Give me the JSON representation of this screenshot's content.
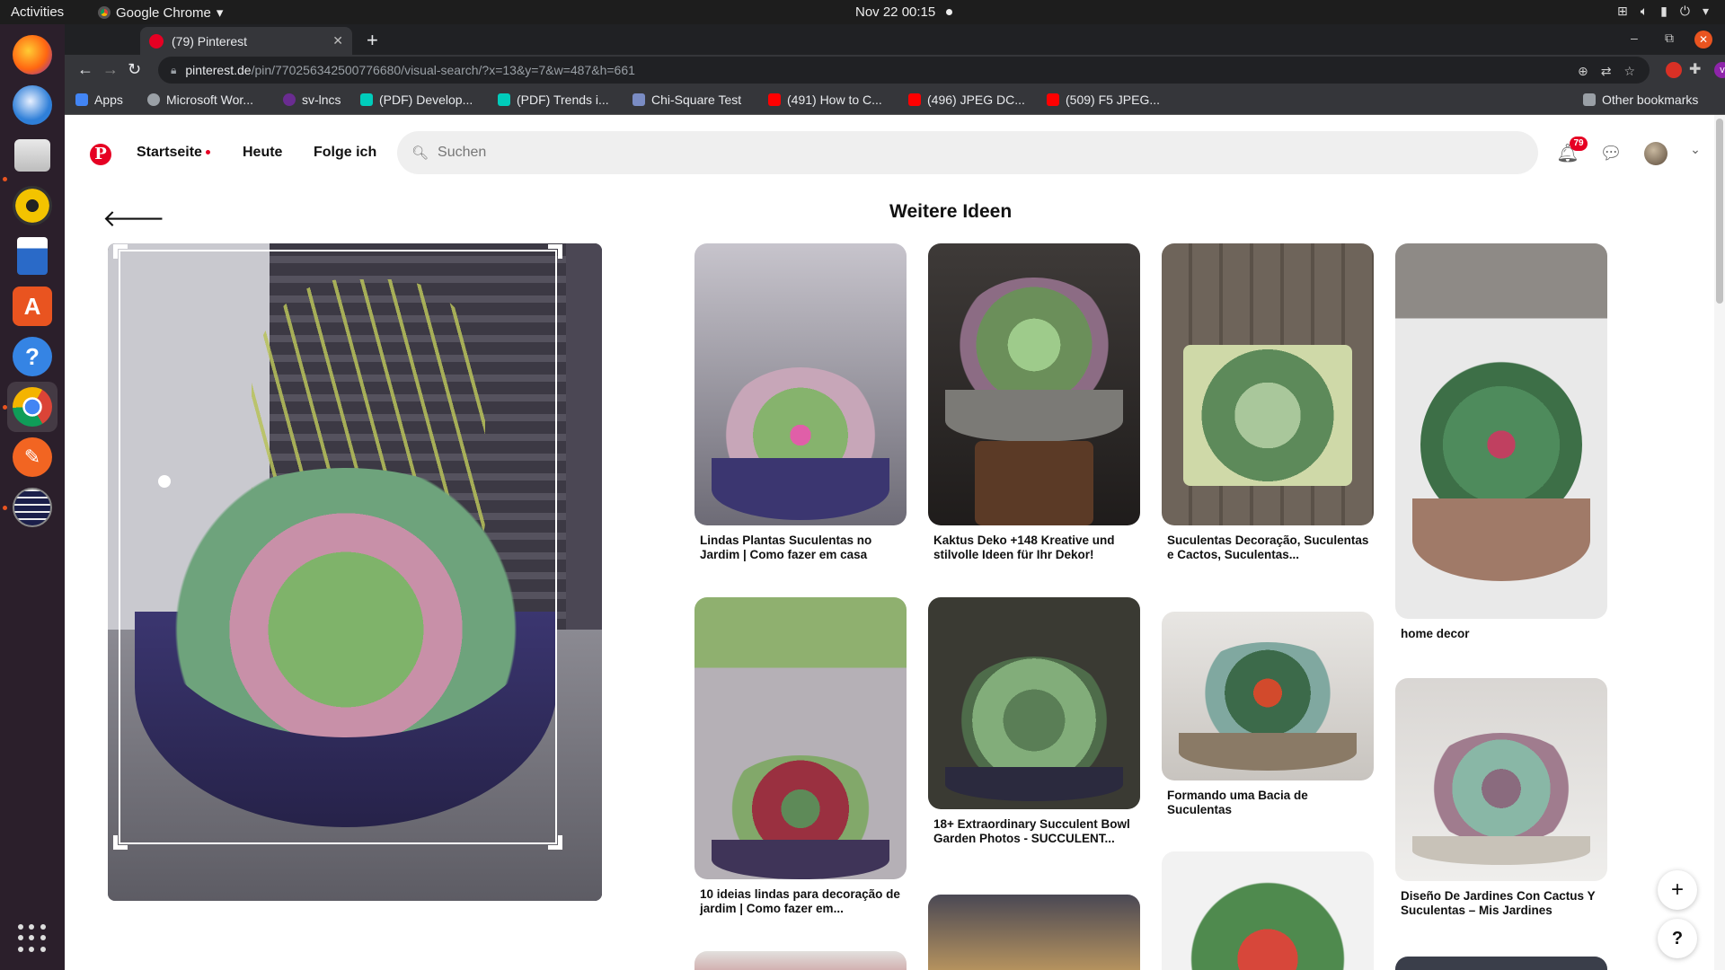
{
  "system": {
    "activities": "Activities",
    "app_menu": "Google Chrome",
    "clock": "Nov 22  00:15"
  },
  "browser": {
    "tab_title": "(79) Pinterest",
    "url_host": "pinterest.de",
    "url_path": "/pin/770256342500776680/visual-search/?x=13&y=7&w=487&h=661",
    "bookmarks": [
      {
        "label": "Apps",
        "icon": "apps-grid-icon",
        "color": "#4285f4"
      },
      {
        "label": "Microsoft Wor...",
        "icon": "globe-icon",
        "color": "#9aa0a6"
      },
      {
        "label": "sv-lncs",
        "icon": "overleaf-icon",
        "color": "#6a2c91"
      },
      {
        "label": "(PDF) Develop...",
        "icon": "researchgate-icon",
        "color": "#00ccbb"
      },
      {
        "label": "(PDF) Trends i...",
        "icon": "researchgate-icon",
        "color": "#00ccbb"
      },
      {
        "label": "Chi-Square Test",
        "icon": "page-icon",
        "color": "#7a8cc4"
      },
      {
        "label": "(491) How to C...",
        "icon": "youtube-icon",
        "color": "#ff0000"
      },
      {
        "label": "(496) JPEG DC...",
        "icon": "youtube-icon",
        "color": "#ff0000"
      },
      {
        "label": "(509) F5 JPEG...",
        "icon": "youtube-icon",
        "color": "#ff0000"
      }
    ],
    "other_bookmarks": "Other bookmarks"
  },
  "pinterest": {
    "nav": {
      "home": "Startseite",
      "today": "Heute",
      "following": "Folge ich"
    },
    "search_placeholder": "Suchen",
    "notification_count": "79",
    "heading": "Weitere Ideen",
    "brand_color": "#e60023",
    "pins": [
      {
        "caption": "Lindas Plantas Suculentas no Jardim | Como fazer em casa"
      },
      {
        "caption": "Kaktus Deko +148 Kreative und stilvolle Ideen für Ihr Dekor!"
      },
      {
        "caption": "Suculentas Decoração, Suculentas e Cactos, Suculentas..."
      },
      {
        "caption": "home decor"
      },
      {
        "caption": "10 ideias lindas para decoração de jardim | Como fazer em..."
      },
      {
        "caption": "18+ Extraordinary Succulent Bowl Garden Photos - SUCCULENT..."
      },
      {
        "caption": "Formando uma Bacia de Suculentas"
      },
      {
        "caption": "Diseño De Jardines Con Cactus Y Suculentas – Mis Jardines"
      }
    ],
    "fab_add": "+",
    "fab_help": "?"
  }
}
